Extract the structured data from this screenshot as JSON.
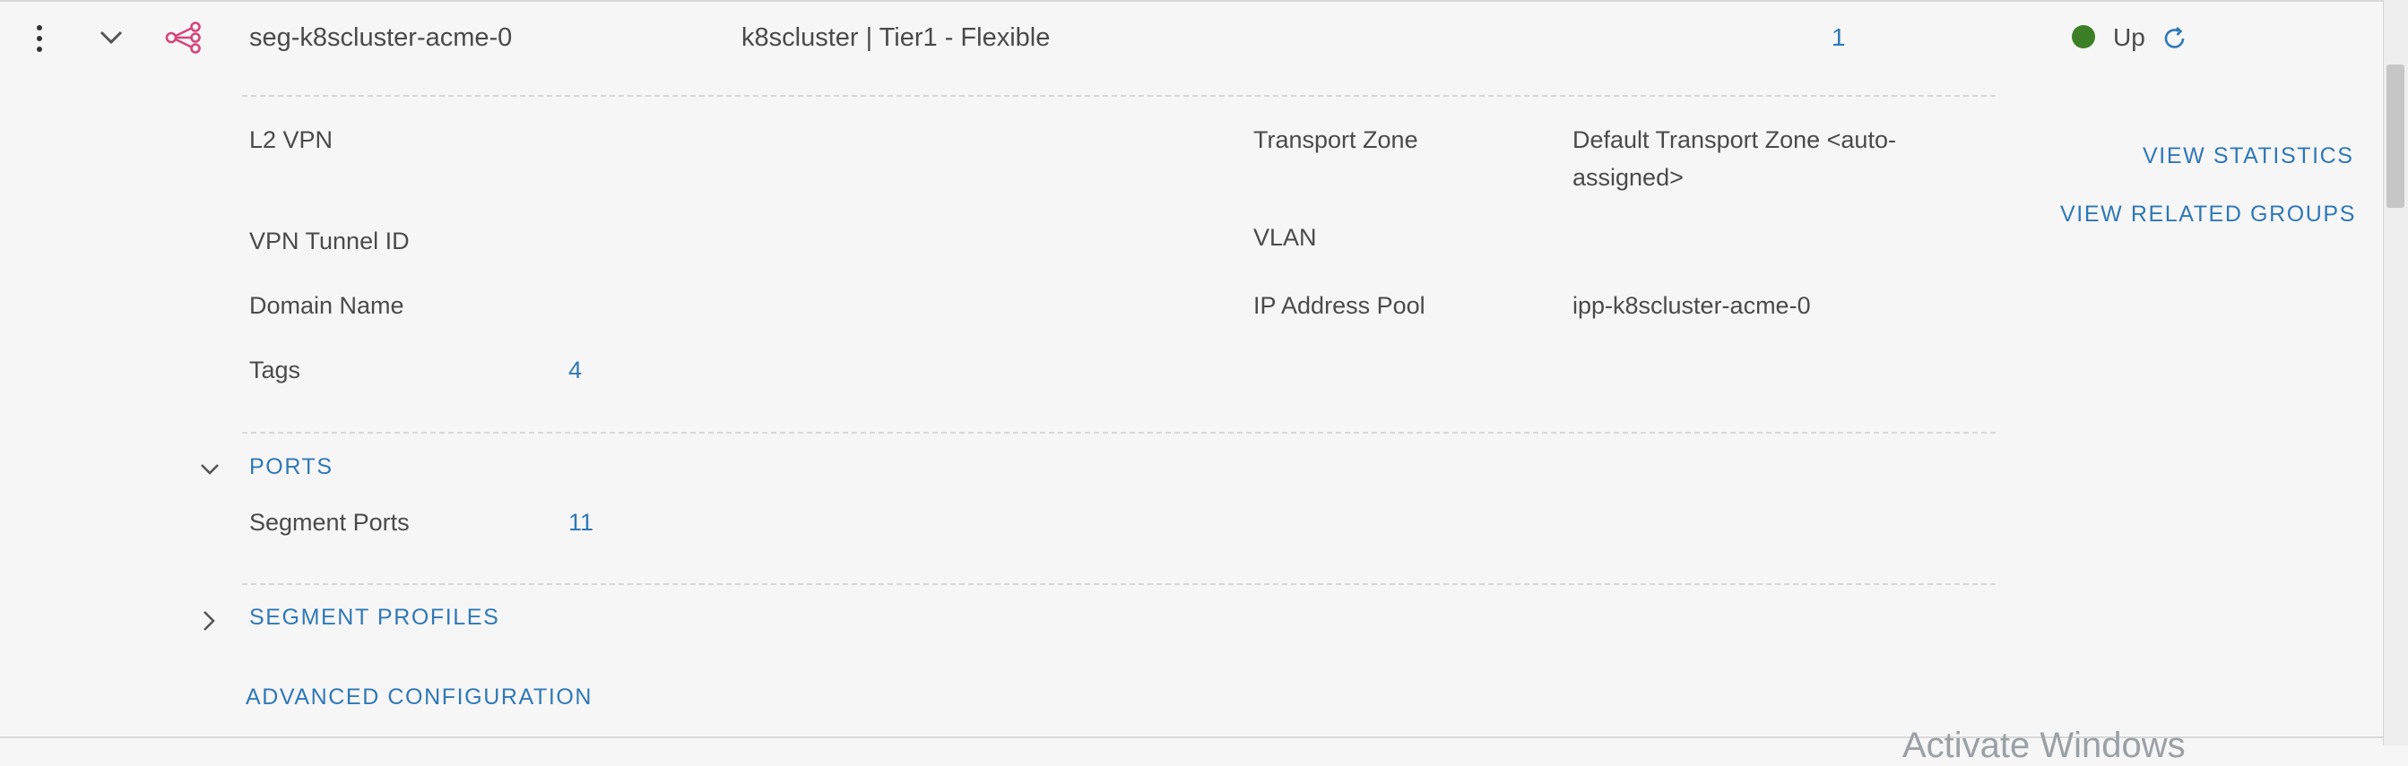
{
  "row": {
    "segment_name": "seg-k8scluster-acme-0",
    "connectivity": "k8scluster | Tier1 - Flexible",
    "count": "1",
    "status": "Up"
  },
  "details": {
    "l2vpn_label": "L2 VPN",
    "vpn_tunnel_label": "VPN Tunnel ID",
    "domain_label": "Domain Name",
    "tags_label": "Tags",
    "tags_value": "4",
    "transport_zone_label": "Transport Zone",
    "transport_zone_value_line1": "Default Transport Zone <auto-",
    "transport_zone_value_line2": "assigned>",
    "vlan_label": "VLAN",
    "ip_pool_label": "IP Address Pool",
    "ip_pool_value": "ipp-k8scluster-acme-0"
  },
  "actions": {
    "view_statistics": "VIEW STATISTICS",
    "view_related_groups": "VIEW RELATED GROUPS"
  },
  "ports": {
    "section_title": "PORTS",
    "segment_ports_label": "Segment Ports",
    "segment_ports_value": "11"
  },
  "profiles": {
    "section_title": "SEGMENT PROFILES"
  },
  "advanced": {
    "label": "ADVANCED CONFIGURATION"
  },
  "watermark": {
    "text": "Activate Windows"
  },
  "colors": {
    "accent": "#2f78b7",
    "status_up": "#3d7f26",
    "segment_icon": "#d6457b"
  }
}
